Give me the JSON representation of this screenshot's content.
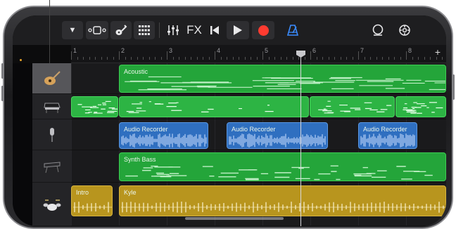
{
  "toolbar": {
    "buttons": [
      {
        "name": "browser-menu-icon",
        "glyph": "▼"
      },
      {
        "name": "view-toggle-icon",
        "glyph": "◦▢◦"
      },
      {
        "name": "smart-controls-icon",
        "glyph": "🎸"
      },
      {
        "name": "tracks-grid-icon",
        "glyph": "▦"
      },
      {
        "name": "mixer-icon",
        "glyph": "⫶"
      },
      {
        "name": "fx-button",
        "glyph": "FX"
      },
      {
        "name": "go-to-beginning-icon",
        "glyph": "⏮"
      },
      {
        "name": "play-icon",
        "glyph": "▶"
      },
      {
        "name": "record-icon",
        "glyph": ""
      },
      {
        "name": "metronome-icon",
        "glyph": "◬"
      },
      {
        "name": "loop-browser-icon",
        "glyph": "○"
      },
      {
        "name": "settings-icon",
        "glyph": "⚙"
      }
    ]
  },
  "ruler": {
    "bars": [
      "1",
      "2",
      "3",
      "4",
      "5",
      "6",
      "7",
      "8"
    ],
    "add_label": "+"
  },
  "tracks": [
    {
      "instrument": "guitar-icon",
      "active": true
    },
    {
      "instrument": "piano-icon",
      "active": false
    },
    {
      "instrument": "microphone-icon",
      "active": false
    },
    {
      "instrument": "keyboard-icon",
      "active": false
    },
    {
      "instrument": "drums-icon",
      "active": false
    }
  ],
  "regions": {
    "acoustic": "Acoustic",
    "audio_recorder_1": "Audio Recorder",
    "audio_recorder_2": "Audio Recorder",
    "audio_recorder_3": "Audio Recorder",
    "synth_bass": "Synth Bass",
    "intro": "Intro",
    "kyle": "Kyle"
  },
  "colors": {
    "software_instrument": "#24a53a",
    "audio_recorder": "#2f6fc0",
    "drummer": "#b8951e",
    "record": "#ff3b30"
  }
}
